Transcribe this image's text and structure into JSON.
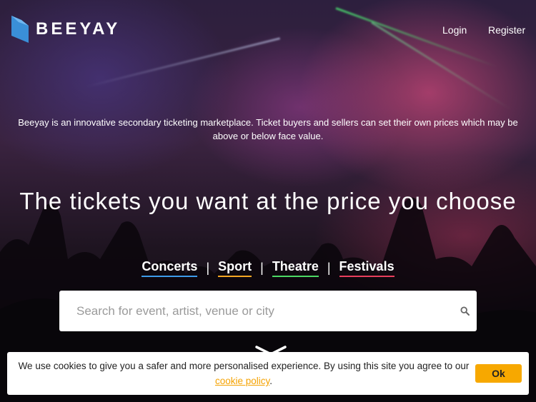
{
  "header": {
    "brand": "BEEYAY",
    "nav": {
      "login": "Login",
      "register": "Register"
    }
  },
  "hero": {
    "intro": "Beeyay is an innovative secondary ticketing marketplace. Ticket buyers and sellers can set their own prices which may be above or below face value.",
    "headline": "The tickets you want at the price you choose"
  },
  "categories": [
    {
      "label": "Concerts",
      "underline_color": "#3d9be9"
    },
    {
      "label": "Sport",
      "underline_color": "#f5a623"
    },
    {
      "label": "Theatre",
      "underline_color": "#4cd964"
    },
    {
      "label": "Festivals",
      "underline_color": "#e83e5c"
    }
  ],
  "category_separator": "|",
  "search": {
    "placeholder": "Search for event, artist, venue or city",
    "icon": "search-icon"
  },
  "cookie_banner": {
    "text": "We use cookies to give you a safer and more personalised experience. By using this site you agree to our",
    "link": "cookie policy",
    "suffix": ".",
    "button": "Ok"
  },
  "colors": {
    "accent": "#f7a800",
    "brand_blue": "#3a8fd8",
    "cookie_link": "#f5a200"
  }
}
